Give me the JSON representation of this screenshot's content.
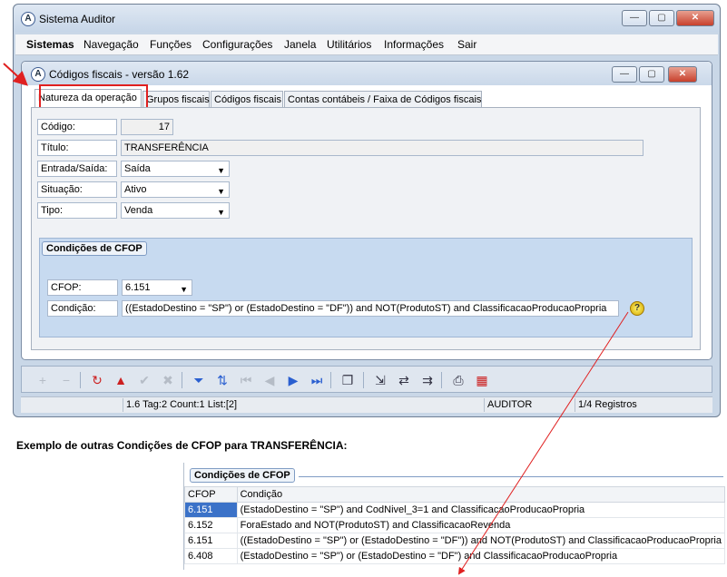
{
  "outer_window": {
    "title": "Sistema Auditor",
    "app_icon_letter": "A",
    "controls": {
      "minimize": "—",
      "maximize": "▢",
      "close": "✕"
    }
  },
  "menu": [
    "Sistemas",
    "Navegação",
    "Funções",
    "Configurações",
    "Janela",
    "Utilitários",
    "Informações",
    "Sair"
  ],
  "inner_window": {
    "title": "Códigos fiscais - versão 1.62",
    "app_icon_letter": "A",
    "controls": {
      "minimize": "—",
      "maximize": "▢",
      "close": "✕"
    }
  },
  "tabs": [
    "Natureza da operação",
    "Grupos fiscais",
    "Códigos fiscais",
    "Contas contábeis / Faixa de Códigos fiscais"
  ],
  "form": {
    "codigo_label": "Código:",
    "codigo_value": "17",
    "titulo_label": "Título:",
    "titulo_value": "TRANSFERÊNCIA",
    "entrada_label": "Entrada/Saída:",
    "entrada_value": "Saída",
    "situacao_label": "Situação:",
    "situacao_value": "Ativo",
    "tipo_label": "Tipo:",
    "tipo_value": "Venda"
  },
  "cfop_group": {
    "title": "Condições de CFOP",
    "cfop_label": "CFOP:",
    "cfop_value": "6.151",
    "condicao_label": "Condição:",
    "condicao_value": "((EstadoDestino = \"SP\") or (EstadoDestino = \"DF\")) and  NOT(ProdutoST) and ClassificacaoProducaoPropria",
    "help_icon": "?"
  },
  "toolbar": {
    "add": "+",
    "remove": "−",
    "refresh": "↻",
    "warning": "▲",
    "confirm": "✔",
    "cancel": "✖",
    "filter": "⏷",
    "sort": "⇅",
    "first": "⏮",
    "prev": "◀",
    "next": "▶",
    "last": "⏭",
    "copy": "❐",
    "export1": "⇲",
    "export2": "⇄",
    "export3": "⇉",
    "print": "⎙",
    "calendar": "▦"
  },
  "status": {
    "info": "1.6 Tag:2 Count:1 List:[2]",
    "user": "AUDITOR",
    "records": "1/4 Registros"
  },
  "example": {
    "heading": "Exemplo de outras Condições de CFOP para TRANSFERÊNCIA:",
    "group_title": "Condições de CFOP",
    "columns": [
      "CFOP",
      "Condição"
    ],
    "rows": [
      [
        "6.151",
        "(EstadoDestino = \"SP\") and  CodNivel_3=1 and ClassificacaoProducaoPropria"
      ],
      [
        "6.152",
        "ForaEstado and NOT(ProdutoST) and ClassificacaoRevenda"
      ],
      [
        "6.151",
        "((EstadoDestino = \"SP\") or (EstadoDestino = \"DF\")) and  NOT(ProdutoST) and ClassificacaoProducaoPropria"
      ],
      [
        "6.408",
        "(EstadoDestino = \"SP\") or (EstadoDestino = \"DF\") and ClassificacaoProducaoPropria"
      ]
    ]
  },
  "colors": {
    "highlight_red": "#e02020",
    "selection_blue": "#3b72c8",
    "group_blue": "#c7daf0"
  }
}
